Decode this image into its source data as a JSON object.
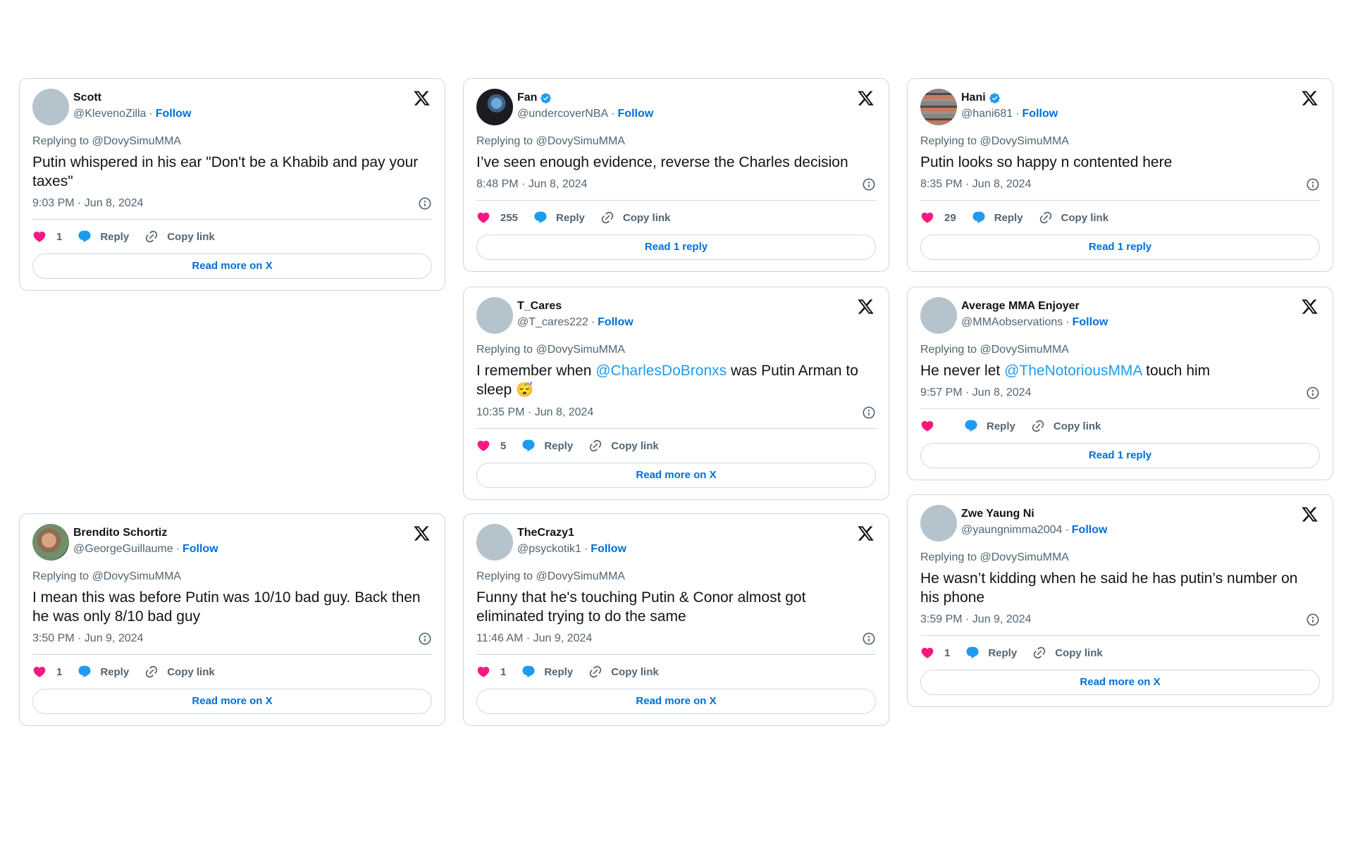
{
  "common": {
    "follow_label": "Follow",
    "reply_label": "Reply",
    "copy_link_label": "Copy link",
    "separator": "·",
    "replying_to": "Replying to @DovySimuMMA"
  },
  "colors": {
    "like": "#f91880",
    "reply": "#1d9bf0",
    "link": "#006fd6",
    "mention": "#1d9bf0",
    "muted": "#536471",
    "border": "#cfd9de"
  },
  "tweets": [
    {
      "name": "Scott",
      "handle": "@KlevenoZilla",
      "verified": false,
      "avatar": "placeholder",
      "text_parts": [
        "Putin whispered in his ear \"Don't be a Khabib and pay your taxes\""
      ],
      "timestamp": "9:03 PM · Jun 8, 2024",
      "likes": "1",
      "cta": "Read more on X"
    },
    {
      "name": "Fan",
      "handle": "@undercoverNBA",
      "verified": true,
      "avatar": "photo-basketball-player",
      "text_parts": [
        "I’ve seen enough evidence, reverse the Charles decision"
      ],
      "timestamp": "8:48 PM · Jun 8, 2024",
      "likes": "255",
      "cta": "Read 1 reply"
    },
    {
      "name": "Hani",
      "handle": "@hani681",
      "verified": true,
      "avatar": "photo-sunset-reflection",
      "text_parts": [
        "Putin looks so happy n contented here"
      ],
      "timestamp": "8:35 PM · Jun 8, 2024",
      "likes": "29",
      "cta": "Read 1 reply"
    },
    {
      "name": "T_Cares",
      "handle": "@T_cares222",
      "verified": false,
      "avatar": "placeholder",
      "text_before": "I remember when ",
      "mention": "@CharlesDoBronxs",
      "text_after": " was Putin Arman to sleep ",
      "emoji": "😴",
      "timestamp": "10:35 PM · Jun 8, 2024",
      "likes": "5",
      "cta": "Read more on X"
    },
    {
      "name": "Average MMA Enjoyer",
      "handle": "@MMAobservations",
      "verified": false,
      "avatar": "placeholder",
      "text_before": "He never let ",
      "mention": "@TheNotoriousMMA",
      "text_after": " touch him",
      "timestamp": "9:57 PM · Jun 8, 2024",
      "likes": "",
      "cta": "Read 1 reply"
    },
    {
      "name": "Brendito Schortiz",
      "handle": "@GeorgeGuillaume",
      "verified": false,
      "avatar": "photo-selfie",
      "text_parts": [
        "I mean this was before Putin was 10/10 bad guy. Back then he was only 8/10 bad guy"
      ],
      "timestamp": "3:50 PM · Jun 9, 2024",
      "likes": "1",
      "cta": "Read more on X"
    },
    {
      "name": "TheCrazy1",
      "handle": "@psyckotik1",
      "verified": false,
      "avatar": "placeholder",
      "text_parts": [
        "Funny that he's touching Putin & Conor almost got eliminated trying to do the same"
      ],
      "timestamp": "11:46 AM · Jun 9, 2024",
      "likes": "1",
      "cta": "Read more on X"
    },
    {
      "name": "Zwe Yaung Ni",
      "handle": "@yaungnimma2004",
      "verified": false,
      "avatar": "placeholder",
      "text_parts": [
        "He wasn’t kidding when he said he has putin’s number on his phone"
      ],
      "timestamp": "3:59 PM · Jun 9, 2024",
      "likes": "1",
      "cta": "Read more on X"
    }
  ]
}
